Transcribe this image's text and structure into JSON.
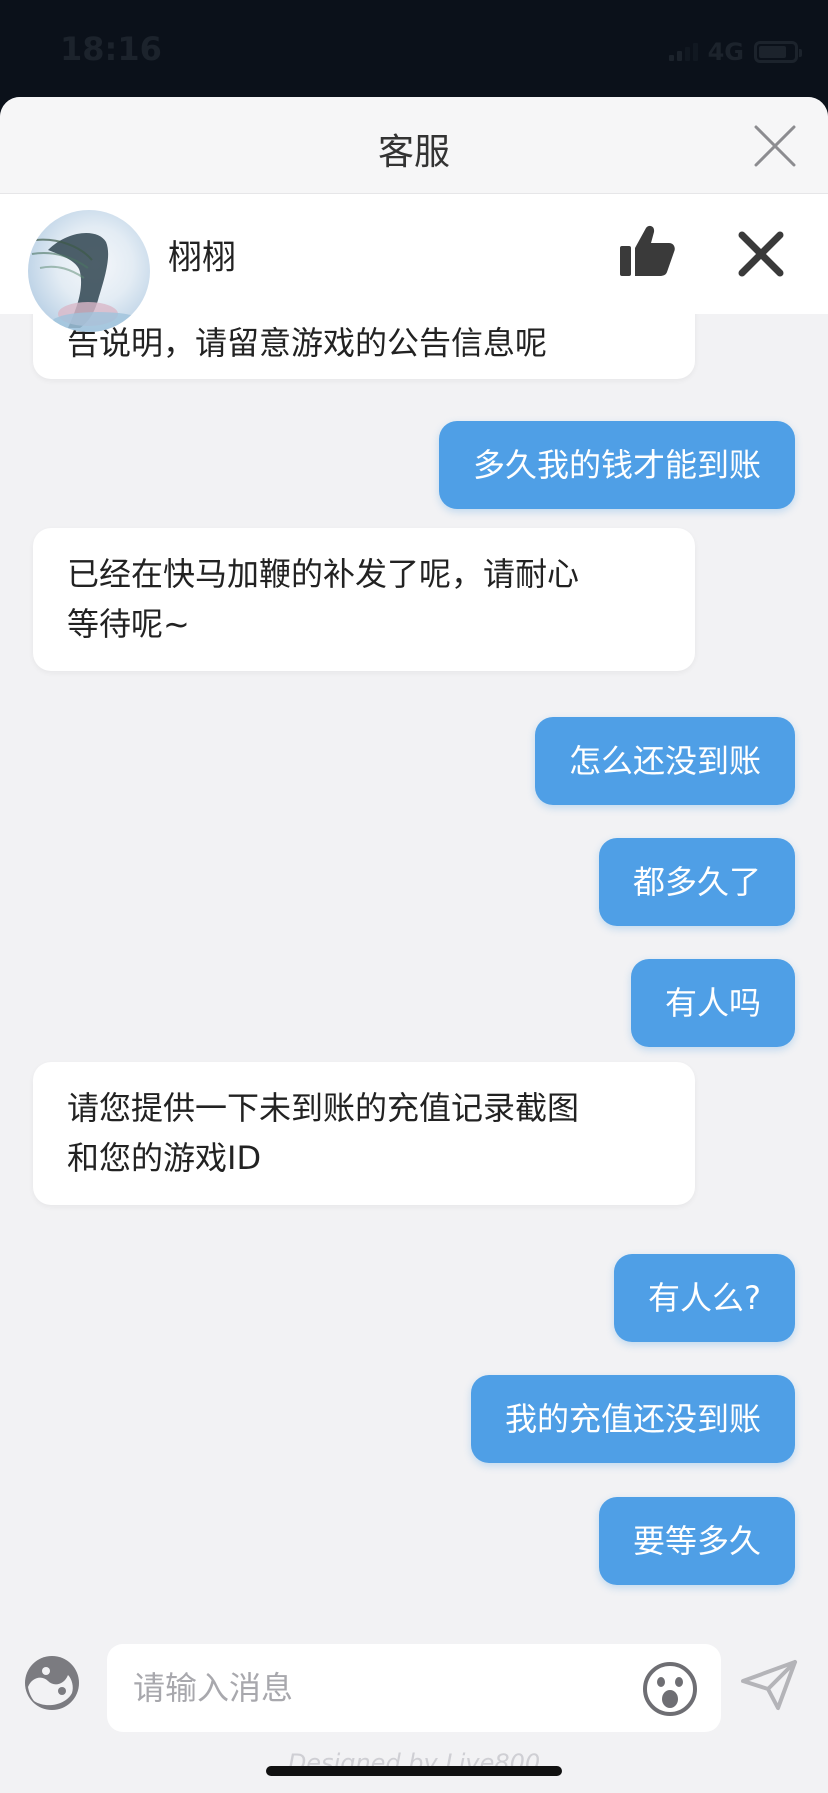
{
  "status": {
    "time": "18:16",
    "network": "4G",
    "battery_level": 0.8
  },
  "header": {
    "title": "客服"
  },
  "agent": {
    "name": "栩栩"
  },
  "messages": [
    {
      "from": "agent",
      "lines": [
        "告说明，请留意游戏的公告信息呢"
      ]
    },
    {
      "from": "user",
      "text": "多久我的钱才能到账"
    },
    {
      "from": "agent",
      "lines": [
        "已经在快马加鞭的补发了呢，请耐心",
        "等待呢~"
      ]
    },
    {
      "from": "user",
      "text": "怎么还没到账"
    },
    {
      "from": "user",
      "text": "都多久了"
    },
    {
      "from": "user",
      "text": "有人吗"
    },
    {
      "from": "agent",
      "lines": [
        "请您提供一下未到账的充值记录截图",
        "和您的游戏ID"
      ]
    },
    {
      "from": "user",
      "text": "有人么?"
    },
    {
      "from": "user",
      "text": "我的充值还没到账"
    },
    {
      "from": "user",
      "text": "要等多久"
    }
  ],
  "input": {
    "placeholder": "请输入消息",
    "value": ""
  },
  "footer": {
    "brand": "Designed by Live800"
  },
  "colors": {
    "accent": "#4f9fe6",
    "background": "#f2f2f4",
    "agent_bubble": "#ffffff"
  }
}
